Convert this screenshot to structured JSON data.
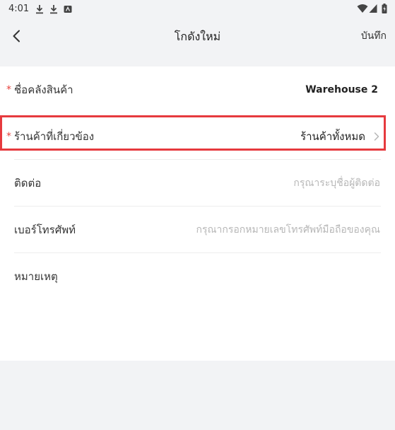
{
  "status_bar": {
    "time": "4:01",
    "left_icons": [
      "download-icon",
      "download-icon",
      "app-notification-icon"
    ],
    "right_icons": [
      "wifi-icon",
      "signal-icon",
      "battery-icon"
    ]
  },
  "header": {
    "title": "โกดังใหม่",
    "save_label": "บันทึก",
    "back_icon": "chevron-left-icon"
  },
  "form": {
    "rows": [
      {
        "label": "ชื่อคลังสินค้า",
        "required": true,
        "value": "Warehouse 2"
      },
      {
        "label": "ร้านค้าที่เกี่ยวข้อง",
        "required": true,
        "value": "ร้านค้าทั้งหมด",
        "icon": "chevron-right-icon"
      },
      {
        "label": "ติดต่อ",
        "required": false,
        "placeholder": "กรุณาระบุชื่อผู้ติดต่อ"
      },
      {
        "label": "เบอร์โทรศัพท์",
        "required": false,
        "placeholder": "กรุณากรอกหมายเลขโทรศัพท์มือถือของคุณ"
      },
      {
        "label": "หมายเหตุ",
        "required": false
      }
    ],
    "required_mark": "*"
  },
  "colors": {
    "background": "#f2f3f5",
    "card": "#ffffff",
    "required": "#e8413c",
    "highlight": "#e63a3e",
    "placeholder": "#b7b7b7"
  }
}
